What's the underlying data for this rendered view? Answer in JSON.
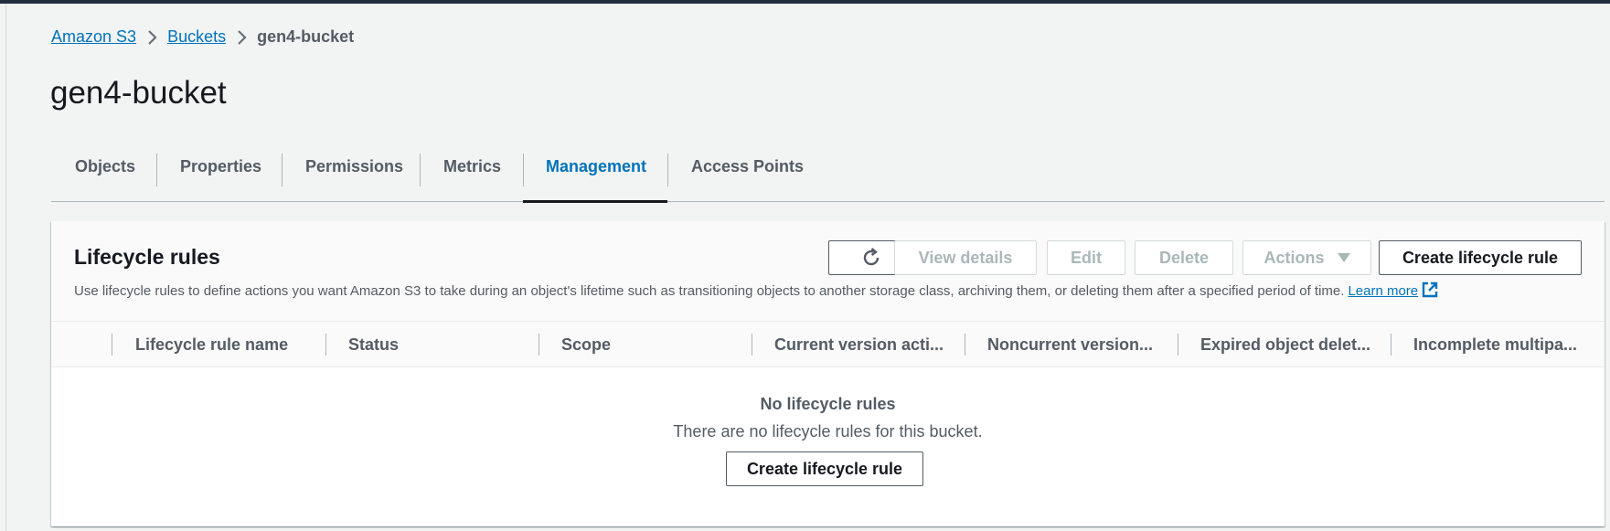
{
  "breadcrumb": {
    "items": [
      "Amazon S3",
      "Buckets"
    ],
    "current": "gen4-bucket"
  },
  "page": {
    "title": "gen4-bucket"
  },
  "tabs": [
    {
      "label": "Objects"
    },
    {
      "label": "Properties"
    },
    {
      "label": "Permissions"
    },
    {
      "label": "Metrics"
    },
    {
      "label": "Management",
      "active": true
    },
    {
      "label": "Access Points"
    }
  ],
  "lifecycle": {
    "title": "Lifecycle rules",
    "description": "Use lifecycle rules to define actions you want Amazon S3 to take during an object's lifetime such as transitioning objects to another storage class, archiving them, or deleting them after a specified period of time.",
    "learn_more": "Learn more",
    "buttons": {
      "refresh_icon": "refresh-icon",
      "view_details": "View details",
      "edit": "Edit",
      "delete": "Delete",
      "actions": "Actions",
      "create": "Create lifecycle rule"
    },
    "columns": [
      "Lifecycle rule name",
      "Status",
      "Scope",
      "Current version acti...",
      "Noncurrent version...",
      "Expired object delet...",
      "Incomplete multipa..."
    ],
    "empty": {
      "title": "No lifecycle rules",
      "text": "There are no lifecycle rules for this bucket.",
      "button": "Create lifecycle rule"
    }
  },
  "colors": {
    "link": "#0073bb",
    "active_tab": "#0073bb",
    "text": "#16191f",
    "muted": "#545b64",
    "disabled": "#aab7b8",
    "background": "#f2f3f3"
  }
}
